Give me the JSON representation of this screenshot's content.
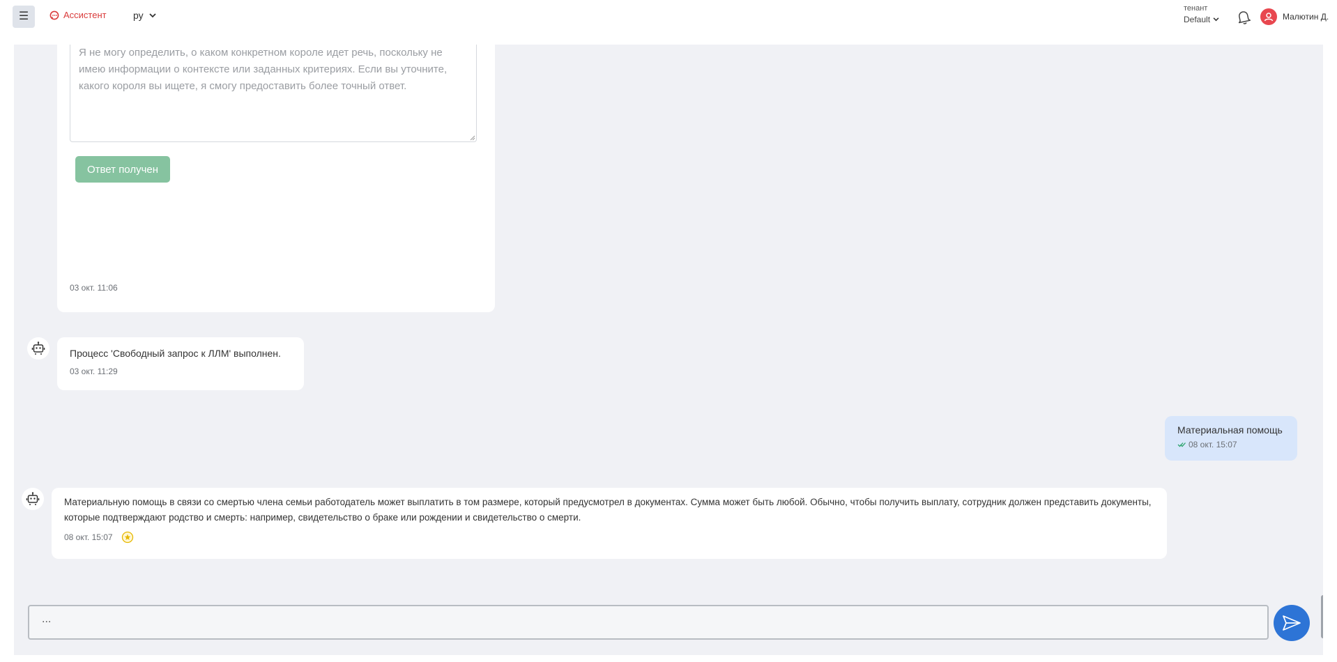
{
  "header": {
    "menu_icon": "hamburger-icon",
    "brand_label": "Ассистент",
    "language": "ру",
    "tenant_label": "тенант",
    "tenant_value": "Default",
    "user_name": "Малютин Д.",
    "colors": {
      "brand": "#d93a3a",
      "avatar": "#e8474f"
    }
  },
  "chat": {
    "messages": [
      {
        "type": "bot-form",
        "textarea_text": "Я не могу определить, о каком конкретном короле идет речь, поскольку не имею информации о контексте или заданных критериях. Если вы уточните, какого короля вы ищете, я смогу предоставить более точный ответ.",
        "button_label": "Ответ получен",
        "timestamp": "03 окт. 11:06"
      },
      {
        "type": "bot",
        "text": "Процесс 'Свободный запрос к ЛЛМ' выполнен.",
        "timestamp": "03 окт. 11:29"
      },
      {
        "type": "user",
        "text": "Материальная помощь",
        "timestamp": "08 окт. 15:07"
      },
      {
        "type": "bot",
        "text": "Материальную помощь в связи со смертью члена семьи работодатель может выплатить в том размере, который предусмотрел в документах. Сумма может быть любой. Обычно, чтобы получить выплату, сотрудник должен представить документы, которые подтверждают родство и смерть: например, свидетельство о браке или рождении и свидетельство о смерти.",
        "timestamp": "08 окт. 15:07"
      }
    ],
    "input_value": "...",
    "colors": {
      "background": "#f0f1f5",
      "user_bubble": "#d8e6fb",
      "send_button": "#2d74d6",
      "answer_button": "#86c3a0"
    }
  }
}
